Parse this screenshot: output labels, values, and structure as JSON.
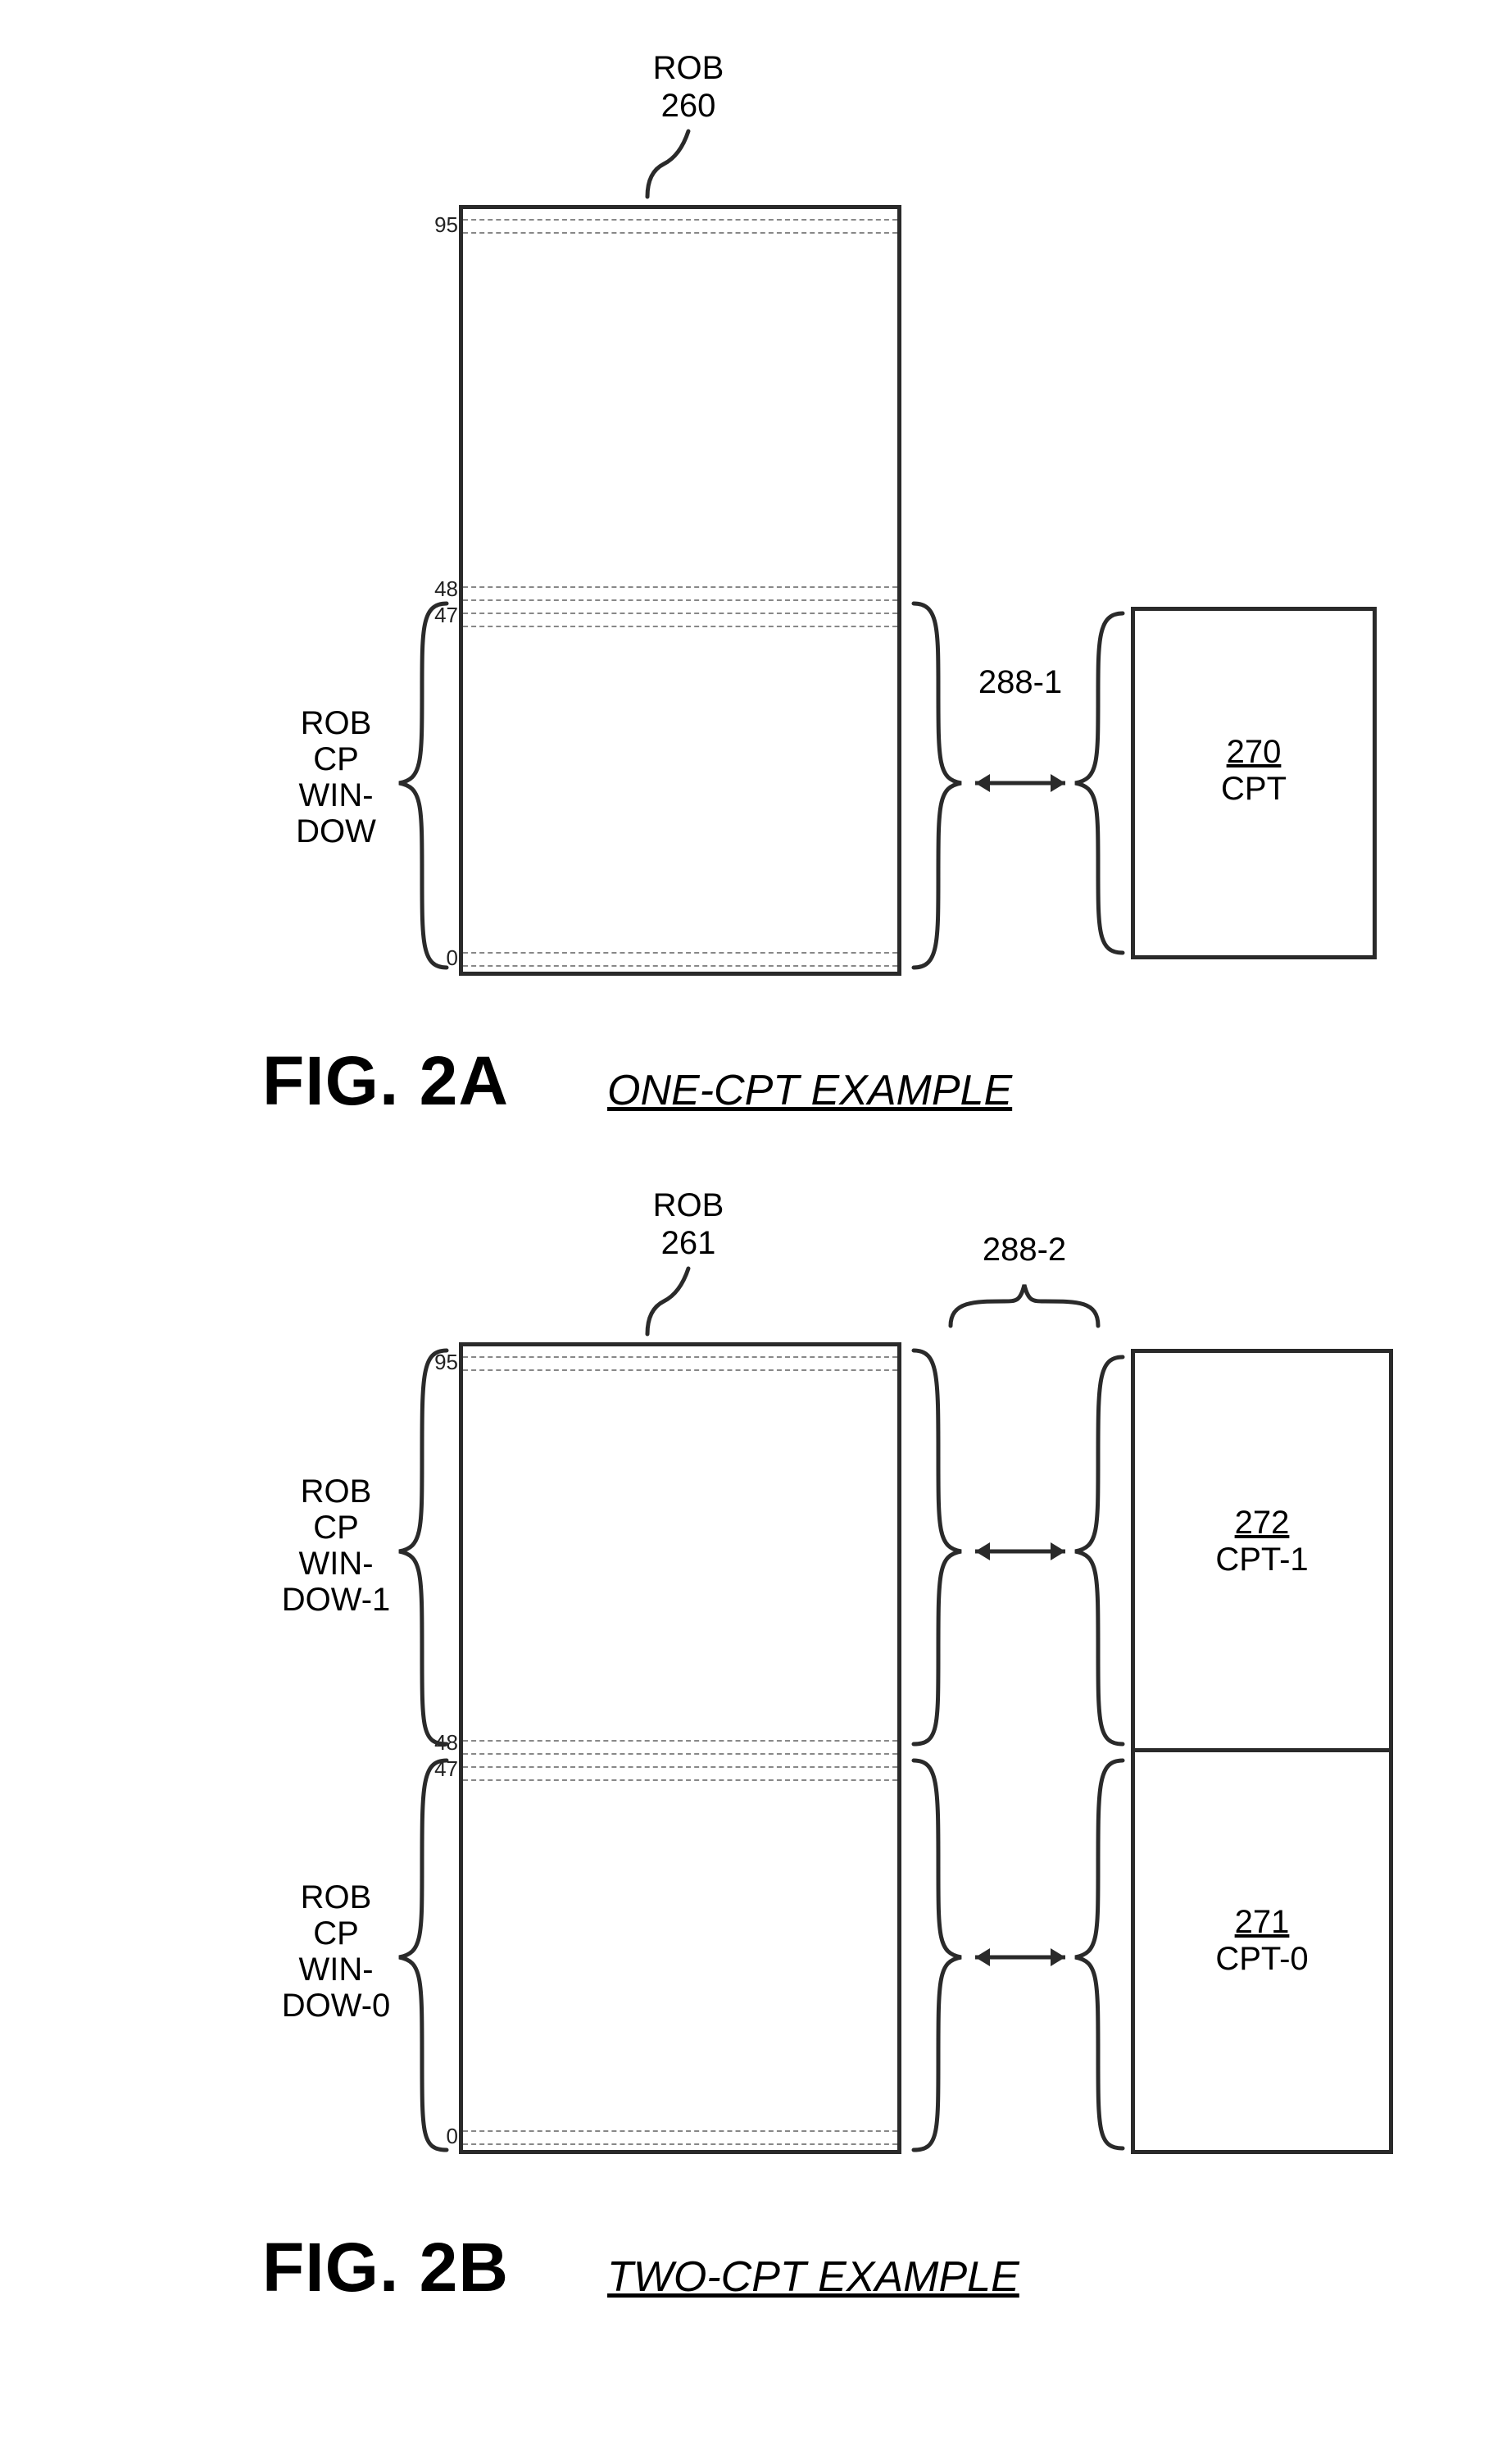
{
  "fig2a": {
    "rob_label": "ROB",
    "rob_num": "260",
    "idx_top": "95",
    "idx_mid_hi": "48",
    "idx_mid_lo": "47",
    "idx_bot": "0",
    "window_label_l1": "ROB",
    "window_label_l2": "CP",
    "window_label_l3": "WIN-",
    "window_label_l4": "DOW",
    "conn_label": "288-1",
    "cpt_num": "270",
    "cpt_label": "CPT",
    "caption": "FIG. 2A",
    "subcaption": "ONE-CPT EXAMPLE"
  },
  "fig2b": {
    "rob_label": "ROB",
    "rob_num": "261",
    "idx_top": "95",
    "idx_mid_hi": "48",
    "idx_mid_lo": "47",
    "idx_bot": "0",
    "win1_l1": "ROB",
    "win1_l2": "CP",
    "win1_l3": "WIN-",
    "win1_l4": "DOW-1",
    "win0_l1": "ROB",
    "win0_l2": "CP",
    "win0_l3": "WIN-",
    "win0_l4": "DOW-0",
    "conn_label": "288-2",
    "cpt1_num": "272",
    "cpt1_label": "CPT-1",
    "cpt0_num": "271",
    "cpt0_label": "CPT-0",
    "caption": "FIG. 2B",
    "subcaption": "TWO-CPT EXAMPLE"
  }
}
